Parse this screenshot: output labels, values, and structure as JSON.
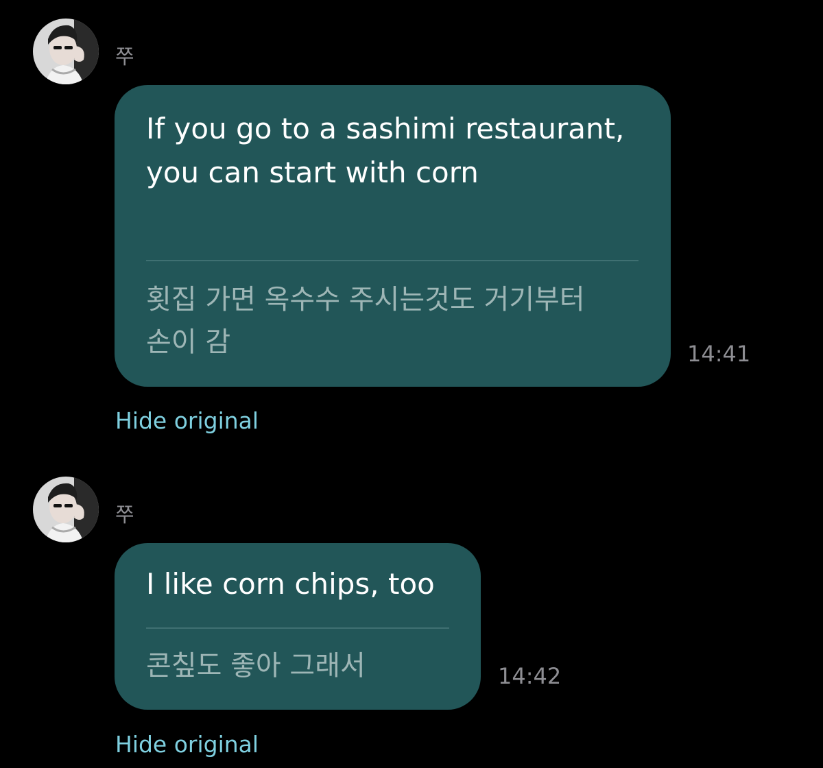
{
  "messages": [
    {
      "sender": "쭈",
      "translated_text": "If you go to a sashimi restaurant,\nyou can start with corn",
      "original_text": "횟집 가면 옥수수 주시는것도 거기부터\n손이 감",
      "time": "14:41",
      "toggle_label": "Hide original"
    },
    {
      "sender": "쭈",
      "translated_text": "I like corn chips, too",
      "original_text": "콘칲도 좋아 그래서",
      "time": "14:42",
      "toggle_label": "Hide original"
    }
  ],
  "colors": {
    "background": "#000000",
    "bubble": "#225658",
    "divider": "#3f7072",
    "original_text": "#9eb6b6",
    "meta_text": "#8e8e93",
    "link": "#7fd0e0"
  }
}
